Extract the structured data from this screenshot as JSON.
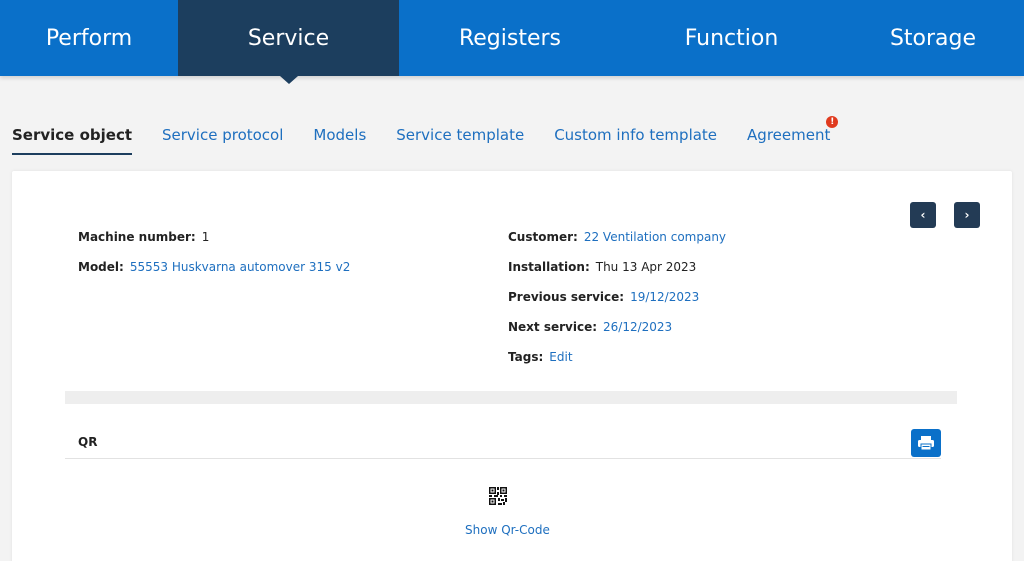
{
  "topnav": {
    "tabs": [
      {
        "label": "Perform"
      },
      {
        "label": "Service"
      },
      {
        "label": "Registers"
      },
      {
        "label": "Function"
      },
      {
        "label": "Storage"
      }
    ]
  },
  "subtabs": {
    "items": [
      {
        "label": "Service object"
      },
      {
        "label": "Service protocol"
      },
      {
        "label": "Models"
      },
      {
        "label": "Service template"
      },
      {
        "label": "Custom info template"
      },
      {
        "label": "Agreement"
      }
    ],
    "agreement_badge": "!"
  },
  "record": {
    "prev_icon": "‹",
    "next_icon": "›",
    "machine_number_label": "Machine number:",
    "machine_number": "1",
    "model_label": "Model:",
    "model": "55553 Huskvarna automover 315 v2",
    "customer_label": "Customer:",
    "customer": "22 Ventilation company",
    "installation_label": "Installation:",
    "installation": "Thu 13 Apr 2023",
    "previous_service_label": "Previous service:",
    "previous_service": "19/12/2023",
    "next_service_label": "Next service:",
    "next_service": "26/12/2023",
    "tags_label": "Tags:",
    "tags_edit": "Edit"
  },
  "qr": {
    "title": "QR",
    "print_icon": "printer-icon",
    "qr_icon": "qr-code-icon",
    "show_link": "Show Qr-Code"
  },
  "colors": {
    "nav_bg": "#0a70c9",
    "nav_active_bg": "#1c3e5e",
    "link": "#1e6fbf",
    "badge": "#e03a1e"
  }
}
